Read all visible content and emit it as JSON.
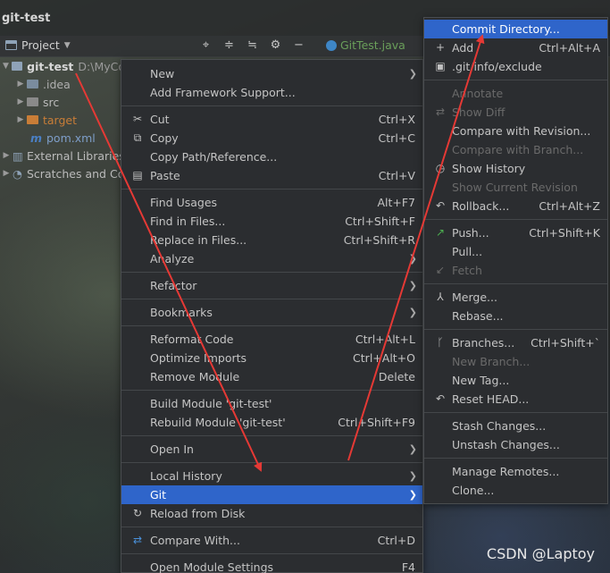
{
  "window": {
    "title": "git-test"
  },
  "toolbar": {
    "project_label": "Project",
    "file_tab": "GitTest.java",
    "icons": [
      "target-icon",
      "expand-all-icon",
      "collapse-all-icon",
      "gear-icon",
      "minimize-icon"
    ]
  },
  "tree": {
    "root_name": "git-test",
    "root_path": "D:\\MyCo",
    "items": [
      {
        "label": ".idea",
        "color": "#7a8c9e"
      },
      {
        "label": "src",
        "color": "#8a8a8a"
      },
      {
        "label": "target",
        "color": "#c97d37"
      },
      {
        "label": "pom.xml",
        "color": "#4a7fc4"
      }
    ],
    "external_libraries": "External Libraries",
    "scratches": "Scratches and Co"
  },
  "context_menu": {
    "new": "New",
    "add_framework": "Add Framework Support...",
    "cut": "Cut",
    "cut_sc": "Ctrl+X",
    "copy": "Copy",
    "copy_sc": "Ctrl+C",
    "copy_path": "Copy Path/Reference...",
    "paste": "Paste",
    "paste_sc": "Ctrl+V",
    "find_usages": "Find Usages",
    "find_usages_sc": "Alt+F7",
    "find_in_files": "Find in Files...",
    "find_in_files_sc": "Ctrl+Shift+F",
    "replace_in_files": "Replace in Files...",
    "replace_in_files_sc": "Ctrl+Shift+R",
    "analyze": "Analyze",
    "refactor": "Refactor",
    "bookmarks": "Bookmarks",
    "reformat": "Reformat Code",
    "reformat_sc": "Ctrl+Alt+L",
    "optimize": "Optimize Imports",
    "optimize_sc": "Ctrl+Alt+O",
    "remove_module": "Remove Module",
    "remove_module_sc": "Delete",
    "build_module": "Build Module 'git-test'",
    "rebuild_module": "Rebuild Module 'git-test'",
    "rebuild_module_sc": "Ctrl+Shift+F9",
    "open_in": "Open In",
    "local_history": "Local History",
    "git": "Git",
    "reload": "Reload from Disk",
    "compare_with": "Compare With...",
    "compare_with_sc": "Ctrl+D",
    "open_module_settings": "Open Module Settings",
    "open_module_settings_sc": "F4"
  },
  "git_menu": {
    "commit_dir": "Commit Directory...",
    "add": "Add",
    "add_sc": "Ctrl+Alt+A",
    "exclude": ".git/info/exclude",
    "annotate": "Annotate",
    "show_diff": "Show Diff",
    "compare_revision": "Compare with Revision...",
    "compare_branch": "Compare with Branch...",
    "show_history": "Show History",
    "show_current_revision": "Show Current Revision",
    "rollback": "Rollback...",
    "rollback_sc": "Ctrl+Alt+Z",
    "push": "Push...",
    "push_sc": "Ctrl+Shift+K",
    "pull": "Pull...",
    "fetch": "Fetch",
    "merge": "Merge...",
    "rebase": "Rebase...",
    "branches": "Branches...",
    "branches_sc": "Ctrl+Shift+`",
    "new_branch": "New Branch...",
    "new_tag": "New Tag...",
    "reset_head": "Reset HEAD...",
    "stash": "Stash Changes...",
    "unstash": "Unstash Changes...",
    "manage_remotes": "Manage Remotes...",
    "clone": "Clone..."
  },
  "watermark": "CSDN @Laptoy",
  "colors": {
    "selection": "#2f65ca",
    "annotation_arrow": "#e53935",
    "menu_bg": "#2b2d30"
  }
}
